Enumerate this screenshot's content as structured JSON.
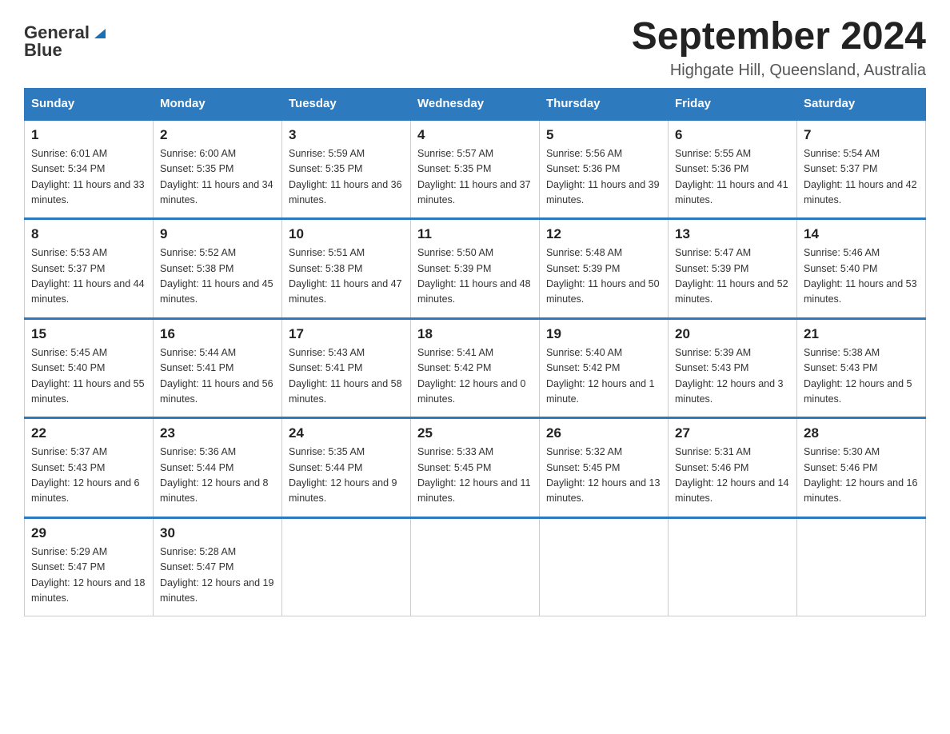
{
  "header": {
    "logo_general": "General",
    "logo_blue": "Blue",
    "title": "September 2024",
    "subtitle": "Highgate Hill, Queensland, Australia"
  },
  "weekdays": [
    "Sunday",
    "Monday",
    "Tuesday",
    "Wednesday",
    "Thursday",
    "Friday",
    "Saturday"
  ],
  "weeks": [
    [
      {
        "day": "1",
        "sunrise": "6:01 AM",
        "sunset": "5:34 PM",
        "daylight": "11 hours and 33 minutes."
      },
      {
        "day": "2",
        "sunrise": "6:00 AM",
        "sunset": "5:35 PM",
        "daylight": "11 hours and 34 minutes."
      },
      {
        "day": "3",
        "sunrise": "5:59 AM",
        "sunset": "5:35 PM",
        "daylight": "11 hours and 36 minutes."
      },
      {
        "day": "4",
        "sunrise": "5:57 AM",
        "sunset": "5:35 PM",
        "daylight": "11 hours and 37 minutes."
      },
      {
        "day": "5",
        "sunrise": "5:56 AM",
        "sunset": "5:36 PM",
        "daylight": "11 hours and 39 minutes."
      },
      {
        "day": "6",
        "sunrise": "5:55 AM",
        "sunset": "5:36 PM",
        "daylight": "11 hours and 41 minutes."
      },
      {
        "day": "7",
        "sunrise": "5:54 AM",
        "sunset": "5:37 PM",
        "daylight": "11 hours and 42 minutes."
      }
    ],
    [
      {
        "day": "8",
        "sunrise": "5:53 AM",
        "sunset": "5:37 PM",
        "daylight": "11 hours and 44 minutes."
      },
      {
        "day": "9",
        "sunrise": "5:52 AM",
        "sunset": "5:38 PM",
        "daylight": "11 hours and 45 minutes."
      },
      {
        "day": "10",
        "sunrise": "5:51 AM",
        "sunset": "5:38 PM",
        "daylight": "11 hours and 47 minutes."
      },
      {
        "day": "11",
        "sunrise": "5:50 AM",
        "sunset": "5:39 PM",
        "daylight": "11 hours and 48 minutes."
      },
      {
        "day": "12",
        "sunrise": "5:48 AM",
        "sunset": "5:39 PM",
        "daylight": "11 hours and 50 minutes."
      },
      {
        "day": "13",
        "sunrise": "5:47 AM",
        "sunset": "5:39 PM",
        "daylight": "11 hours and 52 minutes."
      },
      {
        "day": "14",
        "sunrise": "5:46 AM",
        "sunset": "5:40 PM",
        "daylight": "11 hours and 53 minutes."
      }
    ],
    [
      {
        "day": "15",
        "sunrise": "5:45 AM",
        "sunset": "5:40 PM",
        "daylight": "11 hours and 55 minutes."
      },
      {
        "day": "16",
        "sunrise": "5:44 AM",
        "sunset": "5:41 PM",
        "daylight": "11 hours and 56 minutes."
      },
      {
        "day": "17",
        "sunrise": "5:43 AM",
        "sunset": "5:41 PM",
        "daylight": "11 hours and 58 minutes."
      },
      {
        "day": "18",
        "sunrise": "5:41 AM",
        "sunset": "5:42 PM",
        "daylight": "12 hours and 0 minutes."
      },
      {
        "day": "19",
        "sunrise": "5:40 AM",
        "sunset": "5:42 PM",
        "daylight": "12 hours and 1 minute."
      },
      {
        "day": "20",
        "sunrise": "5:39 AM",
        "sunset": "5:43 PM",
        "daylight": "12 hours and 3 minutes."
      },
      {
        "day": "21",
        "sunrise": "5:38 AM",
        "sunset": "5:43 PM",
        "daylight": "12 hours and 5 minutes."
      }
    ],
    [
      {
        "day": "22",
        "sunrise": "5:37 AM",
        "sunset": "5:43 PM",
        "daylight": "12 hours and 6 minutes."
      },
      {
        "day": "23",
        "sunrise": "5:36 AM",
        "sunset": "5:44 PM",
        "daylight": "12 hours and 8 minutes."
      },
      {
        "day": "24",
        "sunrise": "5:35 AM",
        "sunset": "5:44 PM",
        "daylight": "12 hours and 9 minutes."
      },
      {
        "day": "25",
        "sunrise": "5:33 AM",
        "sunset": "5:45 PM",
        "daylight": "12 hours and 11 minutes."
      },
      {
        "day": "26",
        "sunrise": "5:32 AM",
        "sunset": "5:45 PM",
        "daylight": "12 hours and 13 minutes."
      },
      {
        "day": "27",
        "sunrise": "5:31 AM",
        "sunset": "5:46 PM",
        "daylight": "12 hours and 14 minutes."
      },
      {
        "day": "28",
        "sunrise": "5:30 AM",
        "sunset": "5:46 PM",
        "daylight": "12 hours and 16 minutes."
      }
    ],
    [
      {
        "day": "29",
        "sunrise": "5:29 AM",
        "sunset": "5:47 PM",
        "daylight": "12 hours and 18 minutes."
      },
      {
        "day": "30",
        "sunrise": "5:28 AM",
        "sunset": "5:47 PM",
        "daylight": "12 hours and 19 minutes."
      },
      null,
      null,
      null,
      null,
      null
    ]
  ],
  "labels": {
    "sunrise": "Sunrise:",
    "sunset": "Sunset:",
    "daylight": "Daylight:"
  }
}
